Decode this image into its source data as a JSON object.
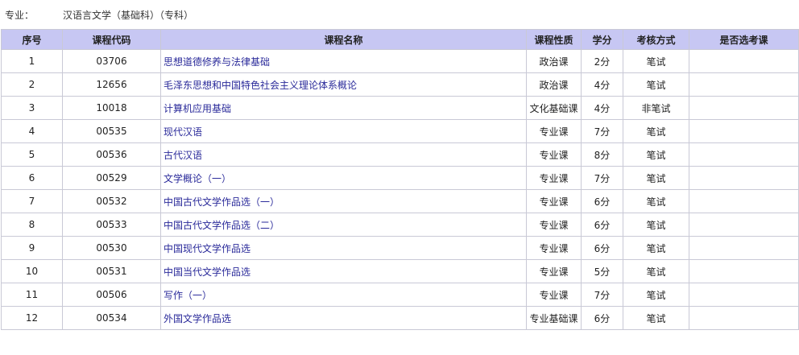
{
  "header": {
    "major_label": "专业：",
    "major_value": "汉语言文学（基础科）（专科）"
  },
  "table": {
    "columns": [
      "序号",
      "课程代码",
      "课程名称",
      "课程性质",
      "学分",
      "考核方式",
      "是否选考课"
    ],
    "rows": [
      {
        "no": "1",
        "code": "03706",
        "name": "思想道德修养与法律基础",
        "type": "政治课",
        "credit": "2分",
        "exam": "笔试",
        "elective": ""
      },
      {
        "no": "2",
        "code": "12656",
        "name": "毛泽东思想和中国特色社会主义理论体系概论",
        "type": "政治课",
        "credit": "4分",
        "exam": "笔试",
        "elective": ""
      },
      {
        "no": "3",
        "code": "10018",
        "name": "计算机应用基础",
        "type": "文化基础课",
        "credit": "4分",
        "exam": "非笔试",
        "elective": ""
      },
      {
        "no": "4",
        "code": "00535",
        "name": "现代汉语",
        "type": "专业课",
        "credit": "7分",
        "exam": "笔试",
        "elective": ""
      },
      {
        "no": "5",
        "code": "00536",
        "name": "古代汉语",
        "type": "专业课",
        "credit": "8分",
        "exam": "笔试",
        "elective": ""
      },
      {
        "no": "6",
        "code": "00529",
        "name": "文学概论（一）",
        "type": "专业课",
        "credit": "7分",
        "exam": "笔试",
        "elective": ""
      },
      {
        "no": "7",
        "code": "00532",
        "name": "中国古代文学作品选（一）",
        "type": "专业课",
        "credit": "6分",
        "exam": "笔试",
        "elective": ""
      },
      {
        "no": "8",
        "code": "00533",
        "name": "中国古代文学作品选（二）",
        "type": "专业课",
        "credit": "6分",
        "exam": "笔试",
        "elective": ""
      },
      {
        "no": "9",
        "code": "00530",
        "name": "中国现代文学作品选",
        "type": "专业课",
        "credit": "6分",
        "exam": "笔试",
        "elective": ""
      },
      {
        "no": "10",
        "code": "00531",
        "name": "中国当代文学作品选",
        "type": "专业课",
        "credit": "5分",
        "exam": "笔试",
        "elective": ""
      },
      {
        "no": "11",
        "code": "00506",
        "name": "写作（一）",
        "type": "专业课",
        "credit": "7分",
        "exam": "笔试",
        "elective": ""
      },
      {
        "no": "12",
        "code": "00534",
        "name": "外国文学作品选",
        "type": "专业基础课",
        "credit": "6分",
        "exam": "笔试",
        "elective": ""
      }
    ]
  },
  "colors": {
    "header_bg": "#c7c7f3",
    "border": "#c9c9d6",
    "link": "#2a2a9a"
  }
}
